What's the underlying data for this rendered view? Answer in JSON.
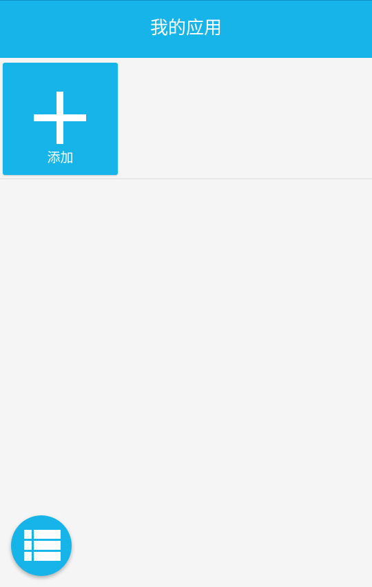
{
  "header": {
    "title": "我的应用"
  },
  "apps": {
    "add_tile": {
      "label": "添加",
      "icon": "plus-icon"
    }
  },
  "fab": {
    "icon": "list-icon"
  },
  "colors": {
    "primary": "#17b4ea",
    "background": "#f5f5f5",
    "on_primary": "#ffffff"
  }
}
